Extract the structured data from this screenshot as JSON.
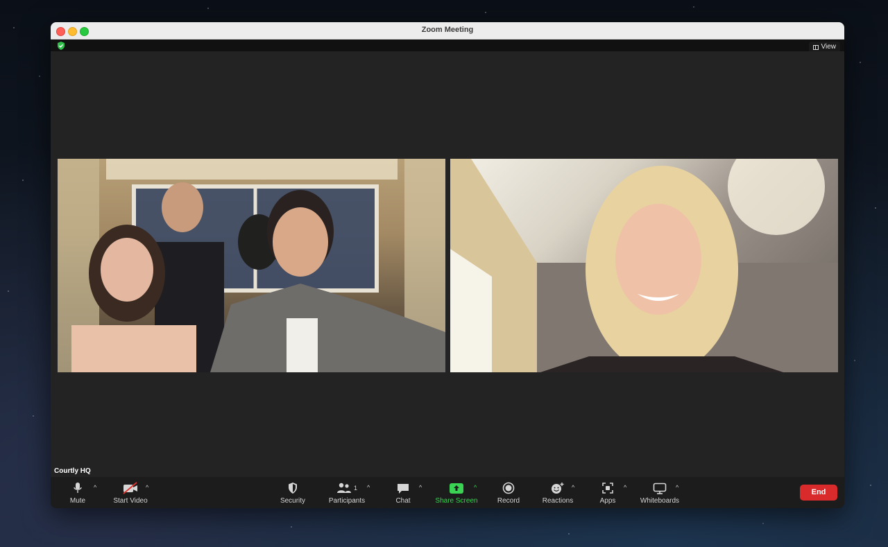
{
  "window": {
    "title": "Zoom Meeting"
  },
  "topbar": {
    "view_label": "View"
  },
  "participant": {
    "name": "Courtly HQ"
  },
  "toolbar": {
    "mute": "Mute",
    "start_video": "Start Video",
    "security": "Security",
    "participants": "Participants",
    "participants_count": "1",
    "chat": "Chat",
    "share_screen": "Share Screen",
    "record": "Record",
    "reactions": "Reactions",
    "apps": "Apps",
    "whiteboards": "Whiteboards",
    "end": "End"
  },
  "colors": {
    "accent_green": "#3ad353",
    "end_red": "#d92b2b",
    "security_green": "#2fbf4a"
  },
  "icons": [
    "shield-check-icon",
    "grid-icon",
    "microphone-icon",
    "video-off-icon",
    "shield-icon",
    "participants-icon",
    "chat-bubble-icon",
    "share-screen-icon",
    "record-icon",
    "reactions-icon",
    "apps-icon",
    "whiteboard-icon",
    "chevron-up-icon"
  ]
}
